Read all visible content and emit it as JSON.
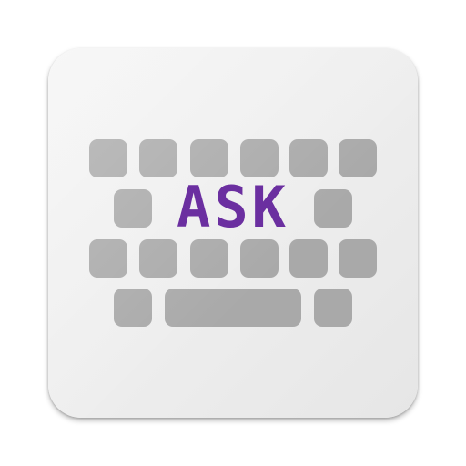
{
  "app_icon": {
    "logo_text": "ASK",
    "colors": {
      "tile_background": "#eeeeee",
      "key_fill": "#a9a9a9",
      "logo_text": "#6b2fa0"
    },
    "icons": [
      "keyboard-key-icon",
      "spacebar-icon"
    ]
  }
}
